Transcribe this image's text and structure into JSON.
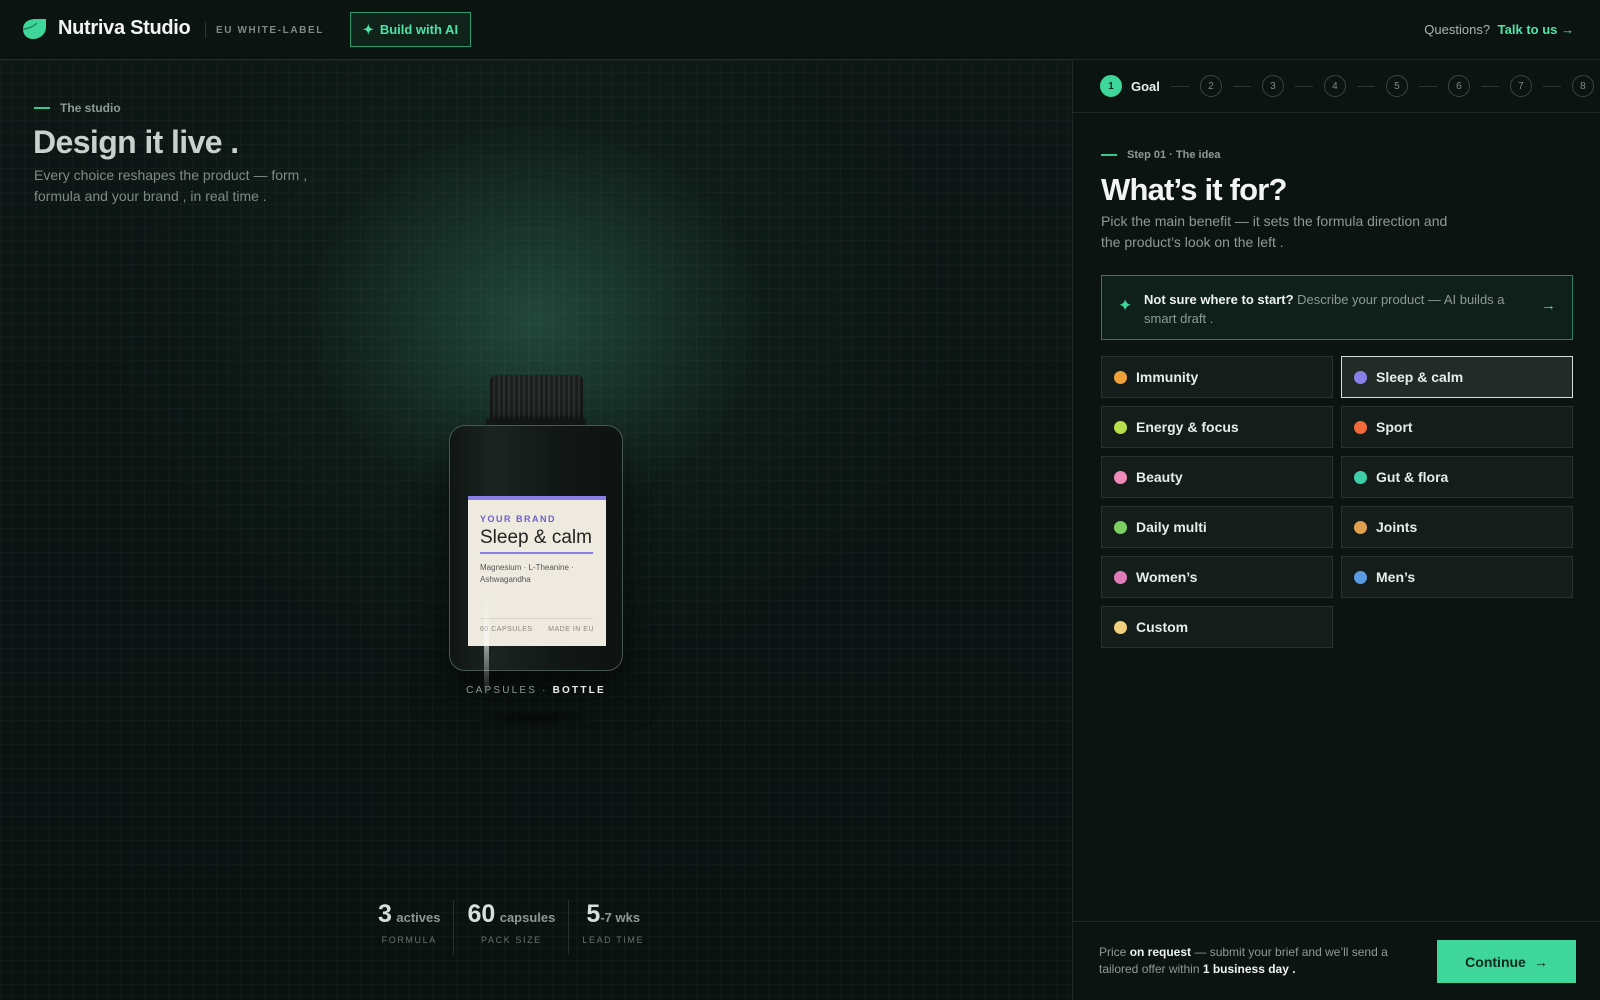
{
  "topbar": {
    "brand": "Nutriva Studio",
    "tag": "EU WHITE-LABEL",
    "ai_button": "Build with AI",
    "questions": "Questions?",
    "talk_link": "Talk to us →"
  },
  "stage": {
    "eyebrow": "The studio",
    "title": "Design it live .",
    "subtitle": "Every choice reshapes the product — form , formula and your brand ,  in real time .",
    "label": {
      "brand": "YOUR BRAND",
      "product": "Sleep & calm",
      "ingredients": "Magnesium · L-Theanine · Ashwagandha",
      "count": "60 CAPSULES",
      "origin": "MADE IN EU",
      "accent": "#8a7ee8"
    },
    "format_prefix": "CAPSULES ·",
    "format_current": "BOTTLE",
    "stats": [
      {
        "value": "3",
        "unit": "actives",
        "caption": "FORMULA"
      },
      {
        "value": "60",
        "unit": "capsules",
        "caption": "PACK SIZE"
      },
      {
        "value": "5",
        "unit": "-7 wks",
        "caption": "LEAD TIME"
      }
    ]
  },
  "stepper": {
    "steps": [
      {
        "num": "1",
        "label": "Goal",
        "active": true
      },
      {
        "num": "2"
      },
      {
        "num": "3"
      },
      {
        "num": "4"
      },
      {
        "num": "5"
      },
      {
        "num": "6"
      },
      {
        "num": "7"
      },
      {
        "num": "8"
      }
    ]
  },
  "panel": {
    "eyebrow": "Step 01 · The idea",
    "title": "What’s it for?",
    "subtitle": "Pick the main benefit — it sets the formula direction and the product’s look on the left .",
    "ai_card": {
      "lead": "Not sure where to start?",
      "text": " Describe your product — AI builds a smart draft ."
    },
    "options": [
      {
        "name": "Immunity",
        "color": "#f0a23a",
        "selected": false
      },
      {
        "name": "Sleep & calm",
        "color": "#8a7ee8",
        "selected": true
      },
      {
        "name": "Energy & focus",
        "color": "#b8e04a",
        "selected": false
      },
      {
        "name": "Sport",
        "color": "#f06a3a",
        "selected": false
      },
      {
        "name": "Beauty",
        "color": "#f08ab8",
        "selected": false
      },
      {
        "name": "Gut & flora",
        "color": "#3ecfa8",
        "selected": false
      },
      {
        "name": "Daily multi",
        "color": "#7ad060",
        "selected": false
      },
      {
        "name": "Joints",
        "color": "#e0a050",
        "selected": false
      },
      {
        "name": "Women’s",
        "color": "#e07ab8",
        "selected": false
      },
      {
        "name": "Men’s",
        "color": "#5a9ae0",
        "selected": false
      },
      {
        "name": "Custom",
        "color": "#f0d07a",
        "selected": false
      }
    ],
    "footer": {
      "price_a": "Price ",
      "price_b": "on request",
      "price_c": " — submit your brief and we’ll send a tailored offer within ",
      "price_d": "1 business day .",
      "continue": "Continue"
    }
  },
  "colors": {
    "accent": "#3ed69a",
    "background": "#0b1310"
  }
}
